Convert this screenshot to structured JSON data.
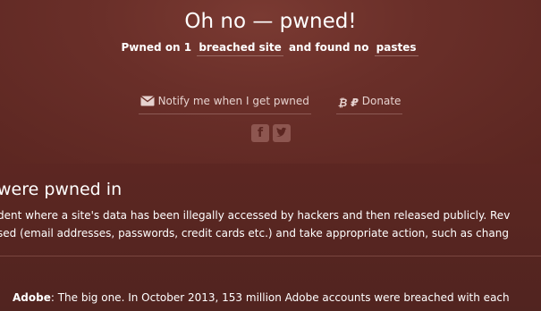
{
  "header": {
    "title": "Oh no — pwned!",
    "sub_prefix": "Pwned on 1",
    "sub_link1": "breached site",
    "sub_mid": "and found no",
    "sub_link2": "pastes"
  },
  "actions": {
    "notify_label": "Notify me when I get pwned",
    "donate_label": "Donate",
    "donate_symbols": "₿ ₽"
  },
  "social": {
    "facebook_icon": "facebook-icon",
    "twitter_icon": "twitter-icon"
  },
  "breaches": {
    "title": "were pwned in",
    "desc_line1": "dent where a site's data has been illegally accessed by hackers and then released publicly. Rev",
    "desc_line2": "sed (email addresses, passwords, credit cards etc.) and take appropriate action, such as chang",
    "items": [
      {
        "name": "Adobe",
        "text": ": The big one. In October 2013, 153 million Adobe accounts were breached with each"
      }
    ]
  },
  "colors": {
    "background": "#5e2722",
    "underline": "#9a6a64",
    "icon_bg": "#8d5650"
  }
}
